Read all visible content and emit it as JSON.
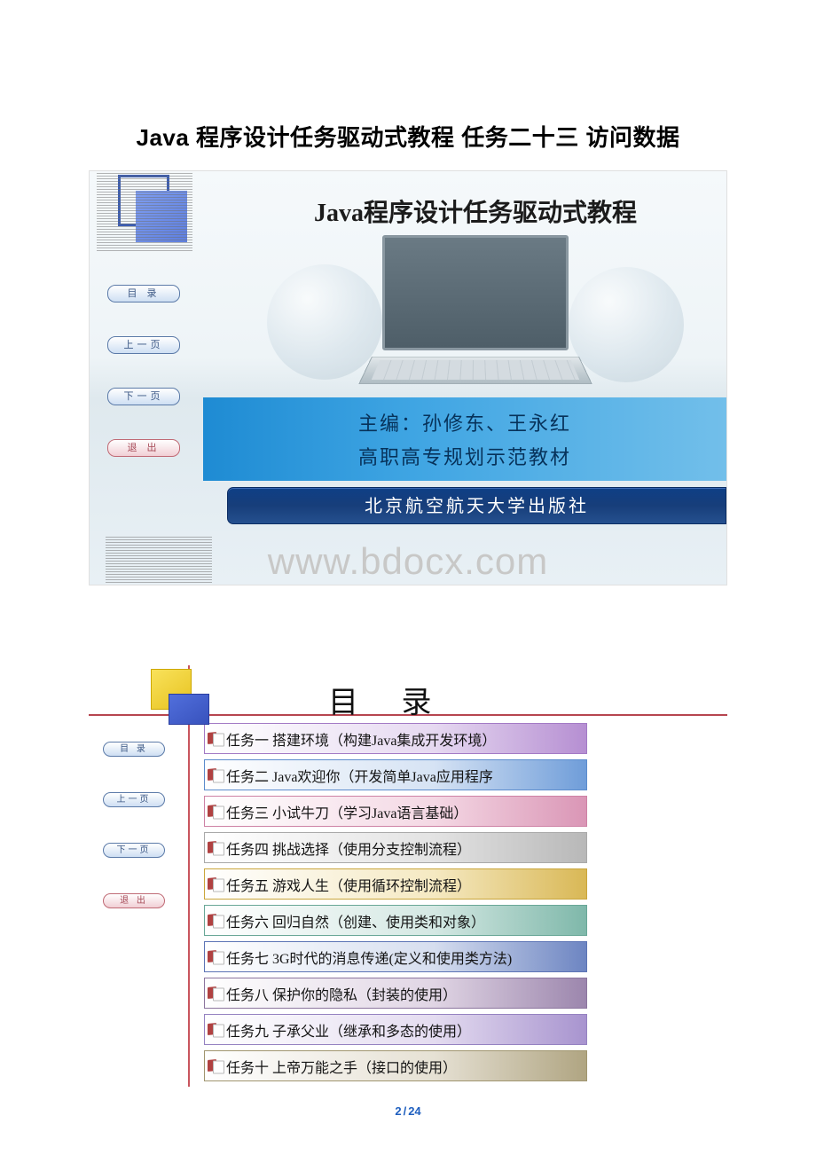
{
  "page_title": "Java 程序设计任务驱动式教程 任务二十三 访问数据",
  "watermark": "www.bdocx.com",
  "nav": {
    "toc": "目 录",
    "prev": "上一页",
    "next": "下一页",
    "exit": "退 出"
  },
  "cover": {
    "arc_title": "Java程序设计任务驱动式教程",
    "editor_line": "主编：孙修东、王永红",
    "series_line": "高职高专规划示范教材",
    "publisher": "北京航空航天大学出版社"
  },
  "toc": {
    "title": "目  录",
    "items": [
      "任务一  搭建环境（构建Java集成开发环境）",
      "任务二  Java欢迎你（开发简单Java应用程序",
      "任务三  小试牛刀（学习Java语言基础）",
      "任务四  挑战选择（使用分支控制流程）",
      "任务五  游戏人生（使用循环控制流程）",
      "任务六  回归自然（创建、使用类和对象）",
      "任务七  3G时代的消息传递(定义和使用类方法)",
      "任务八  保护你的隐私（封装的使用）",
      "任务九  子承父业（继承和多态的使用）",
      "任务十  上帝万能之手（接口的使用）"
    ]
  },
  "pager": {
    "current": "2",
    "separator": "/",
    "total": "24"
  }
}
